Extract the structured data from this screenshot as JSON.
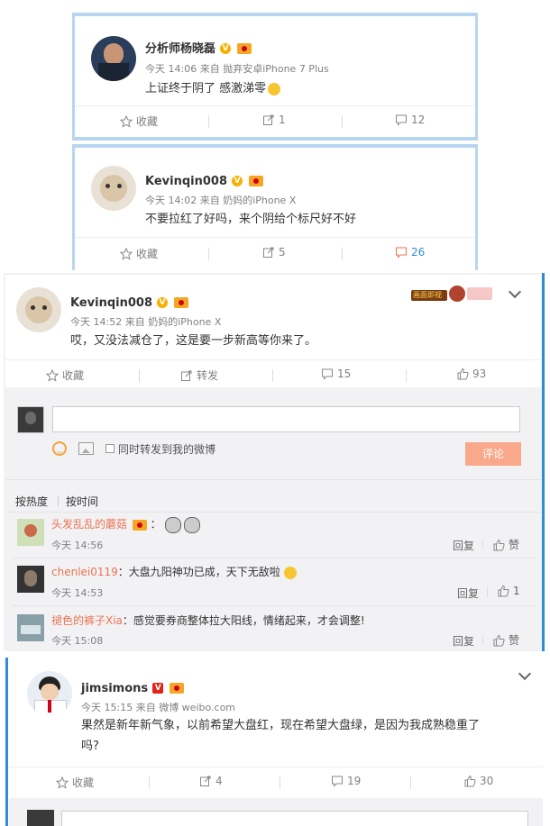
{
  "post1": {
    "user": "分析师杨晓磊",
    "meta": "今天 14:06 来自 抛弃安卓iPhone 7 Plus",
    "text": "上证终于阴了 感激涕零",
    "favorite": "收藏",
    "repost_count": "1",
    "comment_count": "12"
  },
  "post2": {
    "user": "Kevinqin008",
    "meta": "今天 14:02 来自 奶妈的iPhone X",
    "text": "不要拉红了好吗，来个阴给个标尺好不好",
    "favorite": "收藏",
    "repost_count": "5",
    "comment_count": "26"
  },
  "post3": {
    "user": "Kevinqin008",
    "meta": "今天 14:52 来自 奶妈的iPhone X",
    "text": "哎，又没法减仓了，这是要一步新高等你来了。",
    "favorite": "收藏",
    "repost": "转发",
    "comment_count": "15",
    "like_count": "93",
    "forward_check_label": "同时转发到我的微博",
    "comment_button": "评论",
    "sort_hot": "按热度",
    "sort_time": "按时间",
    "badge_text": "画面即视"
  },
  "comments": [
    {
      "user": "头发乱乱的蘑菇",
      "text": "：",
      "time": "今天 14:56",
      "reply": "回复",
      "like": "赞"
    },
    {
      "user": "chenlei0119",
      "text": "：大盘九阳神功已成，天下无敌啦",
      "time": "今天 14:53",
      "reply": "回复",
      "like": "1"
    },
    {
      "user": "褪色的裤子Xia",
      "text": "：感觉要券商整体拉大阳线，情绪起来，才会调整!",
      "time": "今天 15:08",
      "reply": "回复",
      "like": "赞"
    }
  ],
  "post4": {
    "user": "jimsimons",
    "meta": "今天 15:15 来自 微博 weibo.com",
    "text_line1": "果然是新年新气象，以前希望大盘红，现在希望大盘绿，是因为我成熟稳重了",
    "text_line2": "吗?",
    "favorite": "收藏",
    "repost_count": "4",
    "comment_count": "19",
    "like_count": "30"
  },
  "colors": {
    "accent": "#eb7350",
    "border_blue": "#2c8fd6",
    "muted": "#808080"
  }
}
